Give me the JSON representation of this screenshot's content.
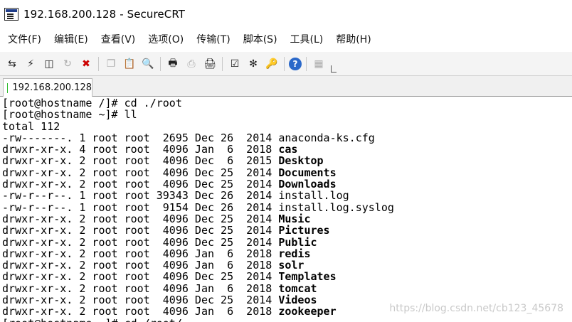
{
  "window": {
    "title": "192.168.200.128 - SecureCRT"
  },
  "menu": [
    "文件(F)",
    "编辑(E)",
    "查看(V)",
    "选项(O)",
    "传输(T)",
    "脚本(S)",
    "工具(L)",
    "帮助(H)"
  ],
  "toolbar": {
    "icons": [
      {
        "name": "connect-icon",
        "glyph": "⇆"
      },
      {
        "name": "quick-connect-icon",
        "glyph": "⚡"
      },
      {
        "name": "connect-tab-icon",
        "glyph": "◫"
      },
      {
        "name": "reconnect-icon",
        "glyph": "↻"
      },
      {
        "name": "disconnect-icon",
        "glyph": "✖"
      },
      {
        "name": "copy-icon",
        "glyph": "❐"
      },
      {
        "name": "paste-icon",
        "glyph": "📋"
      },
      {
        "name": "find-icon",
        "glyph": "🔍"
      },
      {
        "name": "print-screen-icon",
        "glyph": "🖶"
      },
      {
        "name": "print-selection-icon",
        "glyph": "⎙"
      },
      {
        "name": "print-icon",
        "glyph": "🖨"
      },
      {
        "name": "session-options-icon",
        "glyph": "☑"
      },
      {
        "name": "global-options-icon",
        "glyph": "✻"
      },
      {
        "name": "key-map-icon",
        "glyph": "🔑"
      },
      {
        "name": "help-icon",
        "glyph": "?"
      },
      {
        "name": "button-bar-icon",
        "glyph": "▦"
      }
    ]
  },
  "tab": {
    "label": "192.168.200.128",
    "status_color": "#2dbb2d"
  },
  "terminal": {
    "lines": [
      {
        "pre": "[root@hostname /]# cd ./root",
        "name": ""
      },
      {
        "pre": "[root@hostname ~]# ll",
        "name": ""
      },
      {
        "pre": "total 112",
        "name": ""
      },
      {
        "pre": "-rw-------. 1 root root  2695 Dec 26  2014 ",
        "name": "anaconda-ks.cfg",
        "bold": false
      },
      {
        "pre": "drwxr-xr-x. 4 root root  4096 Jan  6  2018 ",
        "name": "cas",
        "bold": true
      },
      {
        "pre": "drwxr-xr-x. 2 root root  4096 Dec  6  2015 ",
        "name": "Desktop",
        "bold": true
      },
      {
        "pre": "drwxr-xr-x. 2 root root  4096 Dec 25  2014 ",
        "name": "Documents",
        "bold": true
      },
      {
        "pre": "drwxr-xr-x. 2 root root  4096 Dec 25  2014 ",
        "name": "Downloads",
        "bold": true
      },
      {
        "pre": "-rw-r--r--. 1 root root 39343 Dec 26  2014 ",
        "name": "install.log",
        "bold": false
      },
      {
        "pre": "-rw-r--r--. 1 root root  9154 Dec 26  2014 ",
        "name": "install.log.syslog",
        "bold": false
      },
      {
        "pre": "drwxr-xr-x. 2 root root  4096 Dec 25  2014 ",
        "name": "Music",
        "bold": true
      },
      {
        "pre": "drwxr-xr-x. 2 root root  4096 Dec 25  2014 ",
        "name": "Pictures",
        "bold": true
      },
      {
        "pre": "drwxr-xr-x. 2 root root  4096 Dec 25  2014 ",
        "name": "Public",
        "bold": true
      },
      {
        "pre": "drwxr-xr-x. 2 root root  4096 Jan  6  2018 ",
        "name": "redis",
        "bold": true
      },
      {
        "pre": "drwxr-xr-x. 2 root root  4096 Jan  6  2018 ",
        "name": "solr",
        "bold": true
      },
      {
        "pre": "drwxr-xr-x. 2 root root  4096 Dec 25  2014 ",
        "name": "Templates",
        "bold": true
      },
      {
        "pre": "drwxr-xr-x. 2 root root  4096 Jan  6  2018 ",
        "name": "tomcat",
        "bold": true
      },
      {
        "pre": "drwxr-xr-x. 2 root root  4096 Dec 25  2014 ",
        "name": "Videos",
        "bold": true
      },
      {
        "pre": "drwxr-xr-x. 2 root root  4096 Jan  6  2018 ",
        "name": "zookeeper",
        "bold": true
      },
      {
        "pre": "[root@hostname ~]# cd /root/",
        "name": ""
      }
    ]
  },
  "watermark": "https://blog.csdn.net/cb123_45678"
}
